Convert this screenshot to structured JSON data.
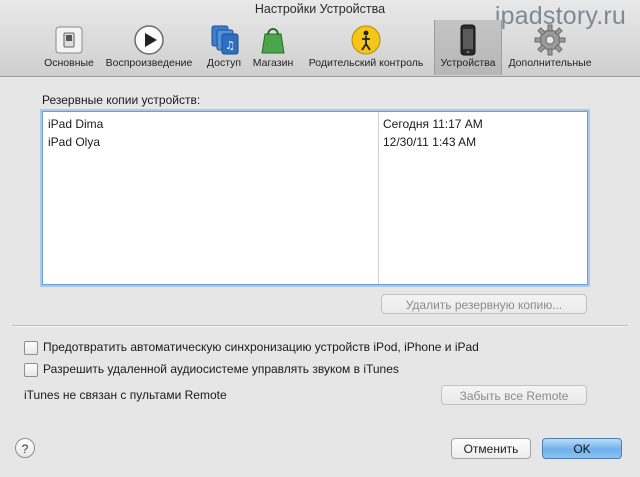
{
  "window": {
    "title": "Настройки Устройства"
  },
  "watermark": "ipadstory.ru",
  "toolbar": {
    "items": [
      {
        "label": "Основные",
        "icon": "switch-icon"
      },
      {
        "label": "Воспроизведение",
        "icon": "play-icon"
      },
      {
        "label": "Доступ",
        "icon": "sharing-icon"
      },
      {
        "label": "Магазин",
        "icon": "shopping-bag-icon"
      },
      {
        "label": "Родительский контроль",
        "icon": "parental-control-icon"
      },
      {
        "label": "Устройства",
        "icon": "iphone-icon",
        "selected": true
      },
      {
        "label": "Дополнительные",
        "icon": "gear-icon"
      }
    ]
  },
  "backups": {
    "label": "Резервные копии устройств:",
    "rows": [
      {
        "name": "iPad Dima",
        "date": "Сегодня 11:17 AM"
      },
      {
        "name": "iPad Olya",
        "date": "12/30/11 1:43 AM"
      }
    ],
    "delete_button": "Удалить резервную копию..."
  },
  "options": {
    "prevent_sync": "Предотвратить автоматическую синхронизацию устройств iPod, iPhone и iPad",
    "allow_remote_audio": "Разрешить удаленной аудиосистеме управлять звуком в iTunes",
    "prevent_sync_checked": false,
    "allow_remote_audio_checked": false
  },
  "remote": {
    "status": "iTunes не связан с пультами Remote",
    "forget_button": "Забыть все Remote"
  },
  "footer": {
    "help": "?",
    "cancel": "Отменить",
    "ok": "OK"
  },
  "colors": {
    "selection_border": "#6a9fd4",
    "primary_button": "#6fb1ec"
  }
}
